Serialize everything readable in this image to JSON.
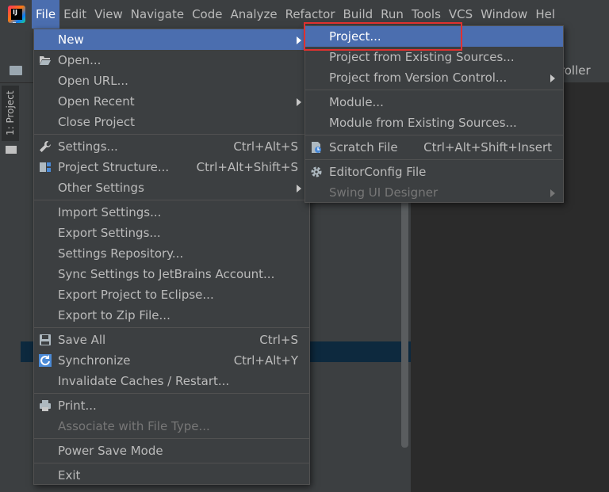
{
  "menubar": {
    "items": [
      "File",
      "Edit",
      "View",
      "Navigate",
      "Code",
      "Analyze",
      "Refactor",
      "Build",
      "Run",
      "Tools",
      "VCS",
      "Window",
      "Hel"
    ]
  },
  "background": {
    "project_tab_label": "1: Project",
    "editor_tab_fragment": "troller"
  },
  "file_menu": {
    "new": "New",
    "open": "Open...",
    "open_url": "Open URL...",
    "open_recent": "Open Recent",
    "close_project": "Close Project",
    "settings": "Settings...",
    "settings_shortcut": "Ctrl+Alt+S",
    "project_structure": "Project Structure...",
    "project_structure_shortcut": "Ctrl+Alt+Shift+S",
    "other_settings": "Other Settings",
    "import_settings": "Import Settings...",
    "export_settings": "Export Settings...",
    "settings_repository": "Settings Repository...",
    "sync_settings": "Sync Settings to JetBrains Account...",
    "export_eclipse": "Export Project to Eclipse...",
    "export_zip": "Export to Zip File...",
    "save_all": "Save All",
    "save_all_shortcut": "Ctrl+S",
    "synchronize": "Synchronize",
    "synchronize_shortcut": "Ctrl+Alt+Y",
    "invalidate_caches": "Invalidate Caches / Restart...",
    "print": "Print...",
    "associate_file_type": "Associate with File Type...",
    "power_save": "Power Save Mode",
    "exit": "Exit"
  },
  "new_submenu": {
    "project": "Project...",
    "project_existing": "Project from Existing Sources...",
    "project_vcs": "Project from Version Control...",
    "module": "Module...",
    "module_existing": "Module from Existing Sources...",
    "scratch_file": "Scratch File",
    "scratch_shortcut": "Ctrl+Alt+Shift+Insert",
    "editorconfig": "EditorConfig File",
    "swing_designer": "Swing UI Designer"
  },
  "colors": {
    "highlight": "#4b6eaf",
    "menu_bg": "#3c3f41",
    "focus_box": "#e0312f"
  }
}
